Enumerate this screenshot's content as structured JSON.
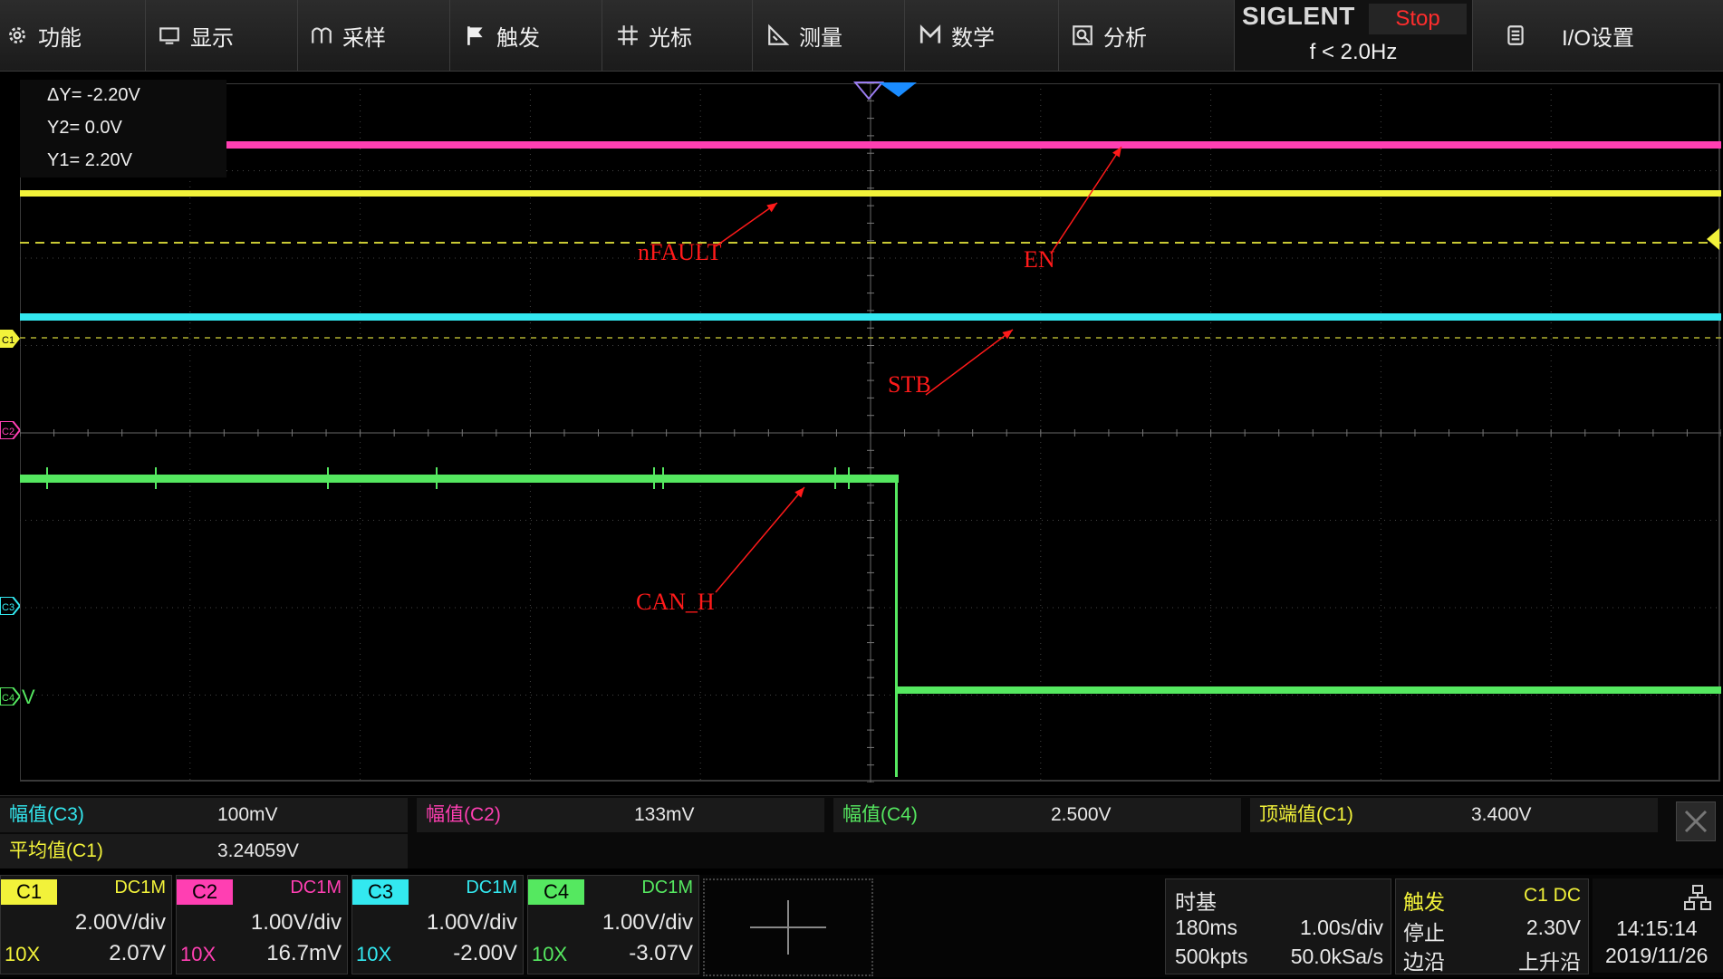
{
  "menu": [
    {
      "label": "功能",
      "icon": "gear-icon"
    },
    {
      "label": "显示",
      "icon": "display-icon"
    },
    {
      "label": "采样",
      "icon": "acquire-icon"
    },
    {
      "label": "触发",
      "icon": "flag-icon"
    },
    {
      "label": "光标",
      "icon": "cursor-icon"
    },
    {
      "label": "测量",
      "icon": "measure-icon"
    },
    {
      "label": "数学",
      "icon": "math-icon"
    },
    {
      "label": "分析",
      "icon": "analysis-icon"
    }
  ],
  "brand": {
    "name": "SIGLENT",
    "run_state": "Stop",
    "trigger_freq": "f < 2.0Hz"
  },
  "io_settings": {
    "label": "I/O设置",
    "icon": "io-icon"
  },
  "cursors": {
    "delta": "ΔY= -2.20V",
    "y2": "Y2= 0.0V",
    "y1": "Y1= 2.20V"
  },
  "annotations": {
    "nfault": "nFAULT",
    "en": "EN",
    "stb": "STB",
    "can_h": "CAN_H"
  },
  "marker_labels": {
    "c1": "C1",
    "c2": "C2",
    "c3": "C3",
    "c4": "C4",
    "c4_unit": "V"
  },
  "colors": {
    "c1": "#f2f23a",
    "c2": "#ff3fb2",
    "c3": "#33e8f0",
    "c4": "#55e860",
    "stop": "#ff2d2d"
  },
  "measurements": [
    {
      "name": "幅值(C3)",
      "value": "100mV",
      "color": "#33e8f0"
    },
    {
      "name": "幅值(C2)",
      "value": "133mV",
      "color": "#ff3fb2"
    },
    {
      "name": "幅值(C4)",
      "value": "2.500V",
      "color": "#55e860"
    },
    {
      "name": "顶端值(C1)",
      "value": "3.400V",
      "color": "#f2f23a"
    },
    {
      "name": "平均值(C1)",
      "value": "3.24059V",
      "color": "#f2f23a"
    }
  ],
  "channels": [
    {
      "tag": "C1",
      "coupling": "DC1M",
      "scale": "2.00V/div",
      "probe": "10X",
      "offset": "2.07V",
      "color": "#f2f23a"
    },
    {
      "tag": "C2",
      "coupling": "DC1M",
      "scale": "1.00V/div",
      "probe": "10X",
      "offset": "16.7mV",
      "color": "#ff3fb2"
    },
    {
      "tag": "C3",
      "coupling": "DC1M",
      "scale": "1.00V/div",
      "probe": "10X",
      "offset": "-2.00V",
      "color": "#33e8f0"
    },
    {
      "tag": "C4",
      "coupling": "DC1M",
      "scale": "1.00V/div",
      "probe": "10X",
      "offset": "-3.07V",
      "color": "#55e860"
    }
  ],
  "timebase": {
    "title": "时基",
    "delay": "180ms",
    "scale": "1.00s/div",
    "memory": "500kpts",
    "sample_rate": "50.0kSa/s"
  },
  "trigger": {
    "title": "触发",
    "source": "C1 DC",
    "mode": "停止",
    "level": "2.30V",
    "type": "边沿",
    "slope": "上升沿"
  },
  "clock": {
    "time": "14:15:14",
    "date": "2019/11/26",
    "icon": "network-icon"
  }
}
